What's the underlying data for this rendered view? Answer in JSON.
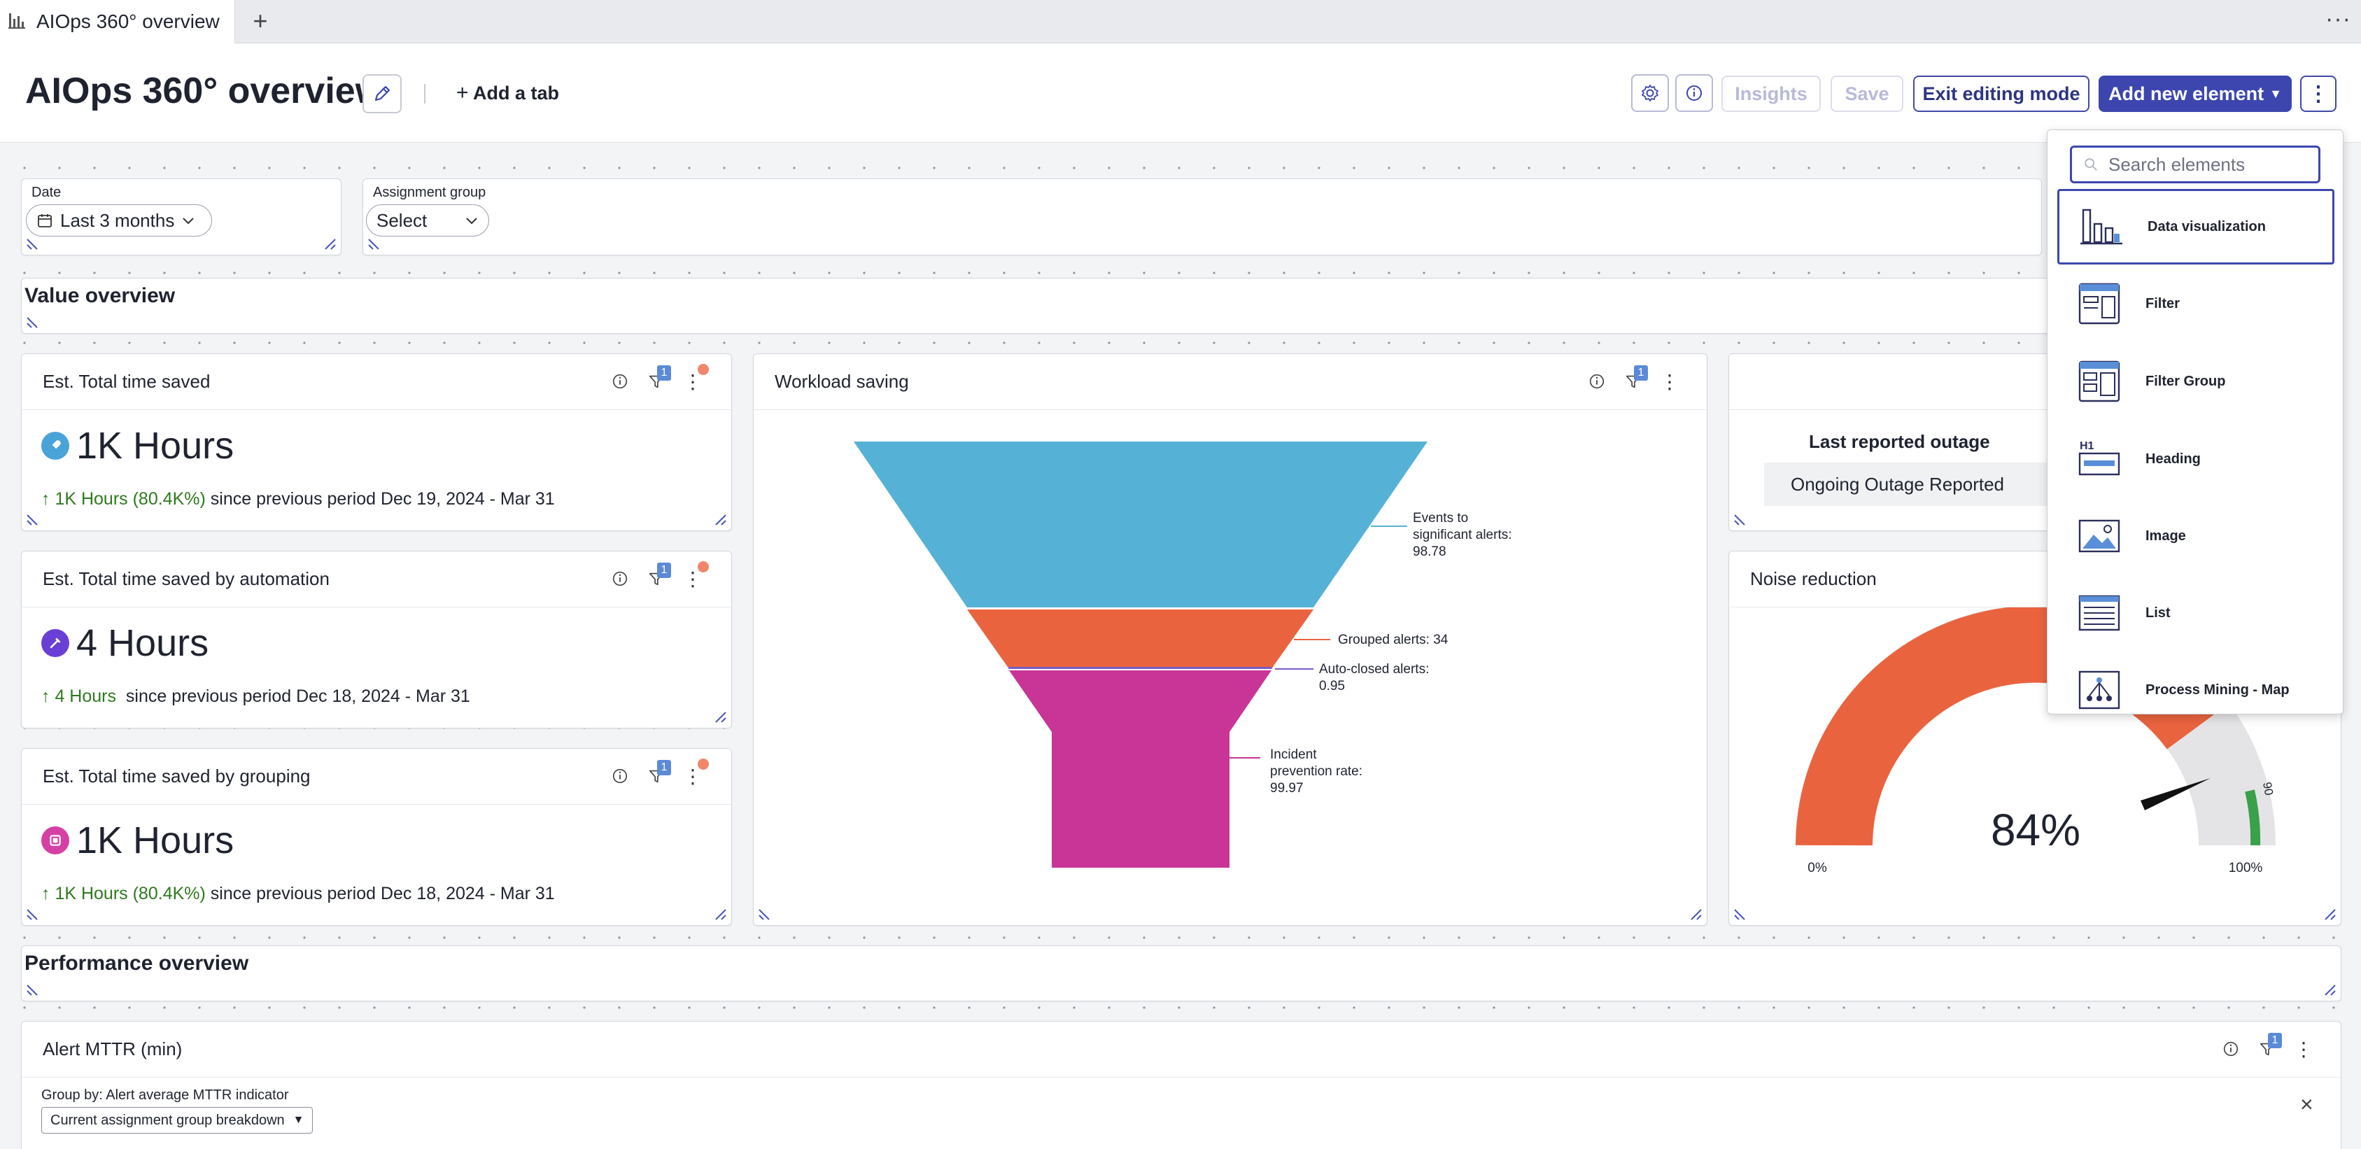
{
  "browser": {
    "tab_title": "AIOps 360° overview",
    "new_tab": "+",
    "more": "···"
  },
  "header": {
    "title": "AIOps 360° overview",
    "add_tab": "Add a tab",
    "insights": "Insights",
    "save": "Save",
    "exit_editing": "Exit editing mode",
    "add_new_element": "Add new element",
    "kebab": "⋮"
  },
  "filters": {
    "date_label": "Date",
    "date_value": "Last 3 months",
    "group_label": "Assignment group",
    "group_value": "Select"
  },
  "sections": {
    "value_overview": "Value overview",
    "performance_overview": "Performance overview"
  },
  "kpis": [
    {
      "title": "Est. Total time saved",
      "value": "1K Hours",
      "trend_value": "1K Hours (80.4K%)",
      "trend_text": " since previous period Dec 19, 2024 - Mar 31",
      "filter_count": "1",
      "badge_color": "#4aa3d8"
    },
    {
      "title": "Est. Total time saved by automation",
      "value": "4 Hours",
      "trend_value": "4 Hours",
      "trend_text": "  since previous period Dec 18, 2024 - Mar 31",
      "filter_count": "1",
      "badge_color": "#6a3fd6"
    },
    {
      "title": "Est. Total time saved by grouping",
      "value": "1K Hours",
      "trend_value": "1K Hours (80.4K%)",
      "trend_text": " since previous period Dec 18, 2024 - Mar 31",
      "filter_count": "1",
      "badge_color": "#d63fa4"
    }
  ],
  "workload": {
    "title": "Workload saving",
    "filter_count": "1",
    "stages": [
      {
        "label_lines": [
          "Events to",
          "significant alerts:",
          "98.78"
        ],
        "value": 98.78,
        "color": "#55b2d6"
      },
      {
        "label_lines": [
          "Grouped alerts: 34"
        ],
        "value": 34,
        "color": "#ea633f"
      },
      {
        "label_lines": [
          "Auto-closed alerts:",
          "0.95"
        ],
        "value": 0.95,
        "color": "#7a5cc8"
      },
      {
        "label_lines": [
          "Incident",
          "prevention rate:",
          "99.97"
        ],
        "value": 99.97,
        "color": "#c93497"
      }
    ]
  },
  "outage": {
    "heading": "Last reported outage",
    "status": "Ongoing Outage Reported"
  },
  "noise": {
    "title": "Noise reduction",
    "value": "84%",
    "min_label": "0%",
    "max_label": "100%",
    "target_label": "90",
    "value_fraction": 0.84,
    "fill_color": "#ea633f",
    "outer_color": "#8b2340",
    "target_color": "#3aa04a"
  },
  "alert_mttr": {
    "title": "Alert MTTR (min)",
    "filter_count": "1",
    "group_by_label": "Group by: Alert average MTTR indicator",
    "group_by_value": "Current assignment group breakdown",
    "close": "×"
  },
  "element_menu": {
    "search_placeholder": "Search elements",
    "items": [
      {
        "label": "Data visualization",
        "icon": "bar-chart-icon"
      },
      {
        "label": "Filter",
        "icon": "filter-element-icon"
      },
      {
        "label": "Filter Group",
        "icon": "filter-group-icon"
      },
      {
        "label": "Heading",
        "icon": "heading-icon"
      },
      {
        "label": "Image",
        "icon": "image-icon"
      },
      {
        "label": "List",
        "icon": "list-icon"
      },
      {
        "label": "Process Mining - Map",
        "icon": "process-map-icon"
      }
    ]
  }
}
